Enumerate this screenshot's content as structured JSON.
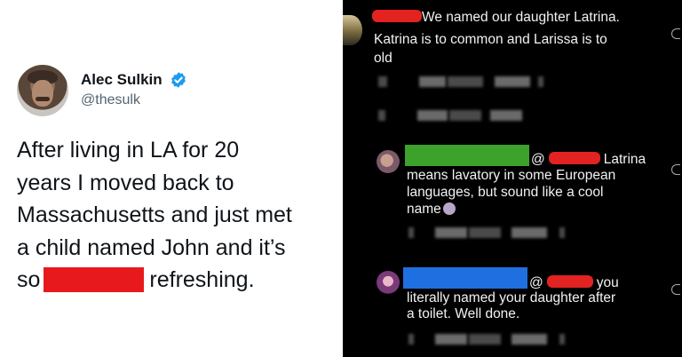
{
  "tweet": {
    "author_name": "Alec Sulkin",
    "author_handle": "@thesulk",
    "icons": [
      "avatar",
      "verified-badge-icon"
    ],
    "lines": [
      "After living in LA for 20",
      "years I moved back to",
      "Massachusetts and just met",
      "a child named John and it’s"
    ],
    "last_line_start": "so",
    "last_line_end": "refreshing.",
    "colors": {
      "redaction": "#e8191c",
      "verified": "#1d9bf0"
    }
  },
  "comments": {
    "first": {
      "line1": "We named our daughter Latrina.",
      "line2": "Katrina is to common and Larissa is to",
      "line3": "old"
    },
    "second": {
      "at": "@",
      "line1_end": "Latrina",
      "line2": "means lavatory in some European",
      "line3": "languages, but sound like a cool",
      "line4": "name"
    },
    "third": {
      "at": "@",
      "line1_end": "you",
      "line2": "literally named your daughter after",
      "line3": "a toilet. Well done."
    },
    "colors": {
      "background": "#000000",
      "red_mark": "#e32222",
      "green_mark": "#3ca22c",
      "blue_mark": "#1f6fe0"
    },
    "icons": [
      "heart-icon"
    ]
  }
}
